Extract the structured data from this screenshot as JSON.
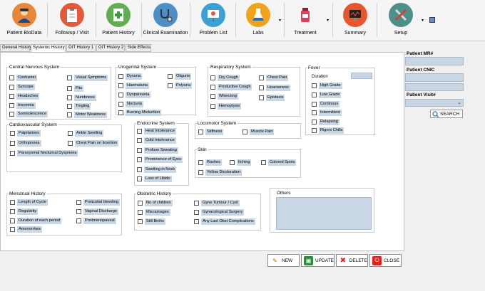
{
  "toolbar": {
    "items": [
      {
        "label": "Patient BioData",
        "icon": "patient-avatar-icon"
      },
      {
        "label": "Followup / Visit",
        "icon": "clipboard-icon"
      },
      {
        "label": "Patient History",
        "icon": "medical-chart-icon"
      },
      {
        "label": "Clinical Examination",
        "icon": "stethoscope-icon"
      },
      {
        "label": "Problem List",
        "icon": "presentation-icon"
      },
      {
        "label": "Labs",
        "icon": "flask-icon"
      },
      {
        "label": "Treatment",
        "icon": "medicine-bottle-icon"
      },
      {
        "label": "Summary",
        "icon": "monitor-icon"
      },
      {
        "label": "Setup",
        "icon": "tools-icon"
      }
    ]
  },
  "tabs": [
    "General History",
    "Systemic History",
    "GIT History 1",
    "GIT History 2",
    "Side Effects"
  ],
  "cns": {
    "title": "Central Nervous System",
    "items": [
      "Confusion",
      "Syncope",
      "Headaches",
      "Insomnia",
      "Somnolescence",
      "Visual Symptoms",
      "Fits",
      "Numbness",
      "Tingling",
      "Motor Weakness"
    ]
  },
  "urogenital": {
    "title": "Urogenital System",
    "items": [
      "Dysuria",
      "Haematuria",
      "Dyspareunia",
      "Nocturia",
      "Burning Micturition",
      "Oliguria",
      "Polyuria"
    ]
  },
  "respiratory": {
    "title": "Respiratory System",
    "items": [
      "Dry Cough",
      "Productive Cough",
      "Wheezing",
      "Hemoptysis",
      "Chest Pain",
      "Hoarseness",
      "Epistaxis"
    ]
  },
  "fever": {
    "title": "Fever",
    "duration_label": "Duration",
    "duration_value": "",
    "items": [
      "High Grade",
      "Low Grade",
      "Continous",
      "Intermittent",
      "Relapsing",
      "Rigors Chills"
    ]
  },
  "cardio": {
    "title": "Cardiovascular System",
    "items": [
      "Palpitations",
      "Orthopnoea",
      "Paroxysmal Nocturnal Dyspnoea",
      "Ankle Swelling",
      "Chest Pain on Exertion"
    ]
  },
  "endocrine": {
    "title": "Endocrine System",
    "items": [
      "Heat Intolerance",
      "Cold Intolerance",
      "Profuse Sweating",
      "Prominence of Eyes",
      "Swelling in Neck",
      "Loss of Libido"
    ]
  },
  "locomotor": {
    "title": "Locomotor System",
    "items": [
      "Stiffness",
      "Muscle Pain"
    ]
  },
  "skin": {
    "title": "Skin",
    "items": [
      "Rashes",
      "Itching",
      "Colored Spots",
      "Yellow Dicoloration"
    ]
  },
  "menstrual": {
    "title": "Menstrual History",
    "items": [
      "Length of Cycle",
      "Regularity",
      "Duration of each period",
      "Amenorrhea",
      "Postcoital bleeding",
      "Vaginal Discharge",
      "Postmenopausal"
    ]
  },
  "obstetric": {
    "title": "Obstetric History",
    "items": [
      "No of children",
      "Miscarriages",
      "Still Births",
      "Gyne Tumour / Cyst",
      "Gynacological Surgery",
      "Any Last Obst Complications"
    ]
  },
  "others": {
    "title": "Others",
    "value": ""
  },
  "sidebar": {
    "mr_label": "Patient MR#",
    "cnic_label": "Patient CNIC",
    "visit_label": "Patient Visit#",
    "search_label": "SEARCH"
  },
  "actions": {
    "new": "NEW",
    "update": "UPDATE",
    "delete": "DELETE",
    "close": "CLOSE"
  },
  "colors": {
    "field_bg": "#c9d7e4",
    "accent_blue": "#2a6db5"
  }
}
